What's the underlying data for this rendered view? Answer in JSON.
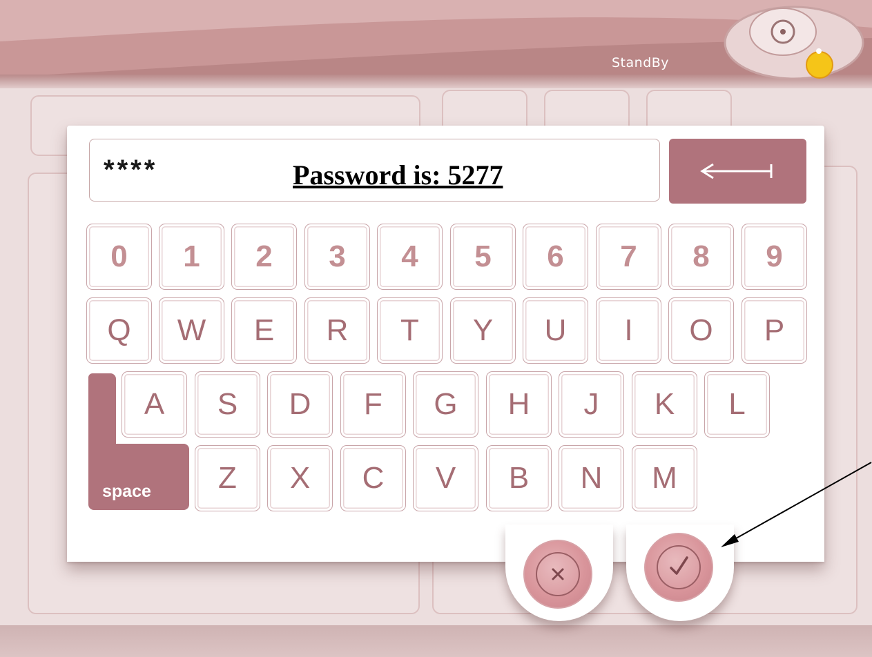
{
  "header": {
    "status_text": "StandBy"
  },
  "password_entry": {
    "masked_value": "****",
    "hint": "Password is: 5277"
  },
  "keypad": {
    "digits": [
      "0",
      "1",
      "2",
      "3",
      "4",
      "5",
      "6",
      "7",
      "8",
      "9"
    ],
    "row_q": [
      "Q",
      "W",
      "E",
      "R",
      "T",
      "Y",
      "U",
      "I",
      "O",
      "P"
    ],
    "row_a": [
      "A",
      "S",
      "D",
      "F",
      "G",
      "H",
      "J",
      "K",
      "L"
    ],
    "row_z": [
      "Z",
      "X",
      "C",
      "V",
      "B",
      "N",
      "M"
    ],
    "space_label": "space",
    "backspace_icon": "backspace-arrow-icon"
  },
  "actions": {
    "cancel_icon": "cancel-x-icon",
    "confirm_icon": "confirm-check-icon"
  },
  "annotation": {
    "arrow_icon": "pointer-arrow-icon"
  },
  "colors": {
    "accent": "#b0737c",
    "key_text": "#a56d74",
    "header": "#c99696",
    "power_led": "#f5c518"
  }
}
